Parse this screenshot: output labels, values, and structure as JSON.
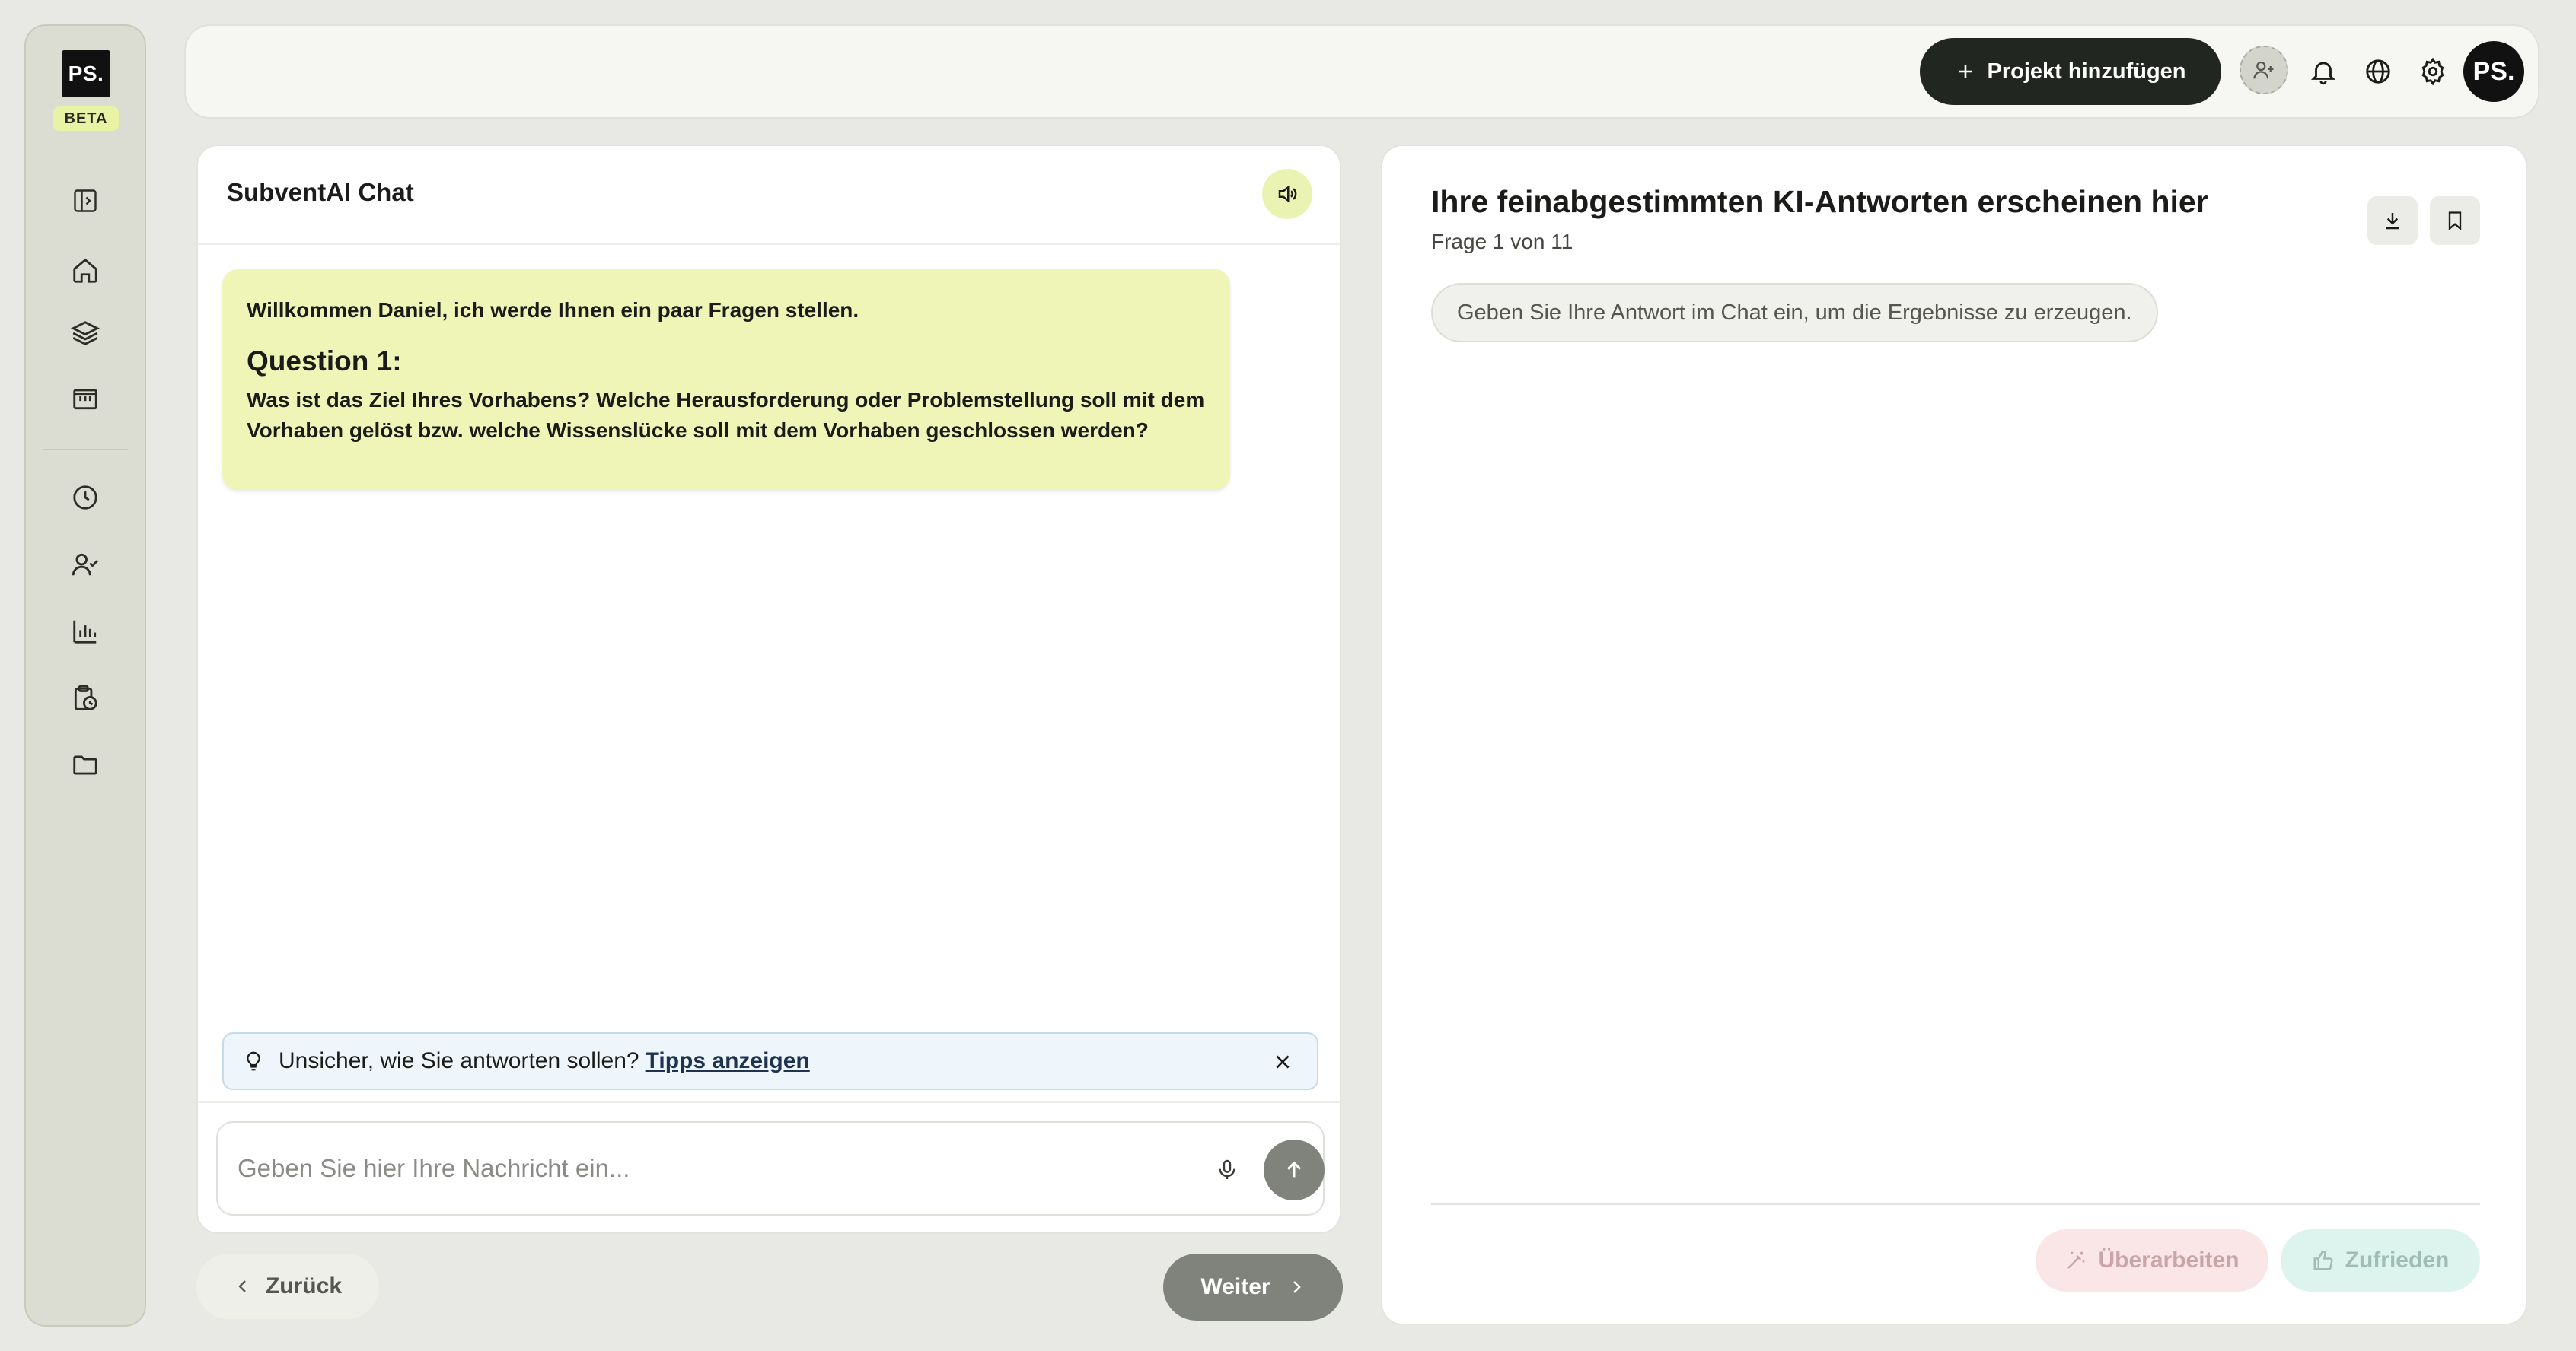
{
  "sidebar": {
    "logo_text": "PS.",
    "beta_label": "BETA",
    "items": [
      {
        "icon": "sidebar-toggle-icon"
      },
      {
        "icon": "home-icon"
      },
      {
        "icon": "layers-icon"
      },
      {
        "icon": "building-icon"
      },
      {
        "icon": "clock-icon"
      },
      {
        "icon": "user-check-icon"
      },
      {
        "icon": "bar-chart-icon"
      },
      {
        "icon": "clipboard-clock-icon"
      },
      {
        "icon": "folder-icon"
      }
    ]
  },
  "topbar": {
    "add_project_label": "Projekt hinzufügen",
    "avatar_text": "PS."
  },
  "chat": {
    "title": "SubventAI Chat",
    "greeting": "Willkommen Daniel, ich werde Ihnen ein paar Fragen stellen.",
    "question_heading": "Question 1:",
    "question_text": "Was ist das Ziel Ihres Vorhabens? Welche Herausforderung oder Problemstellung soll mit dem Vorhaben gelöst bzw. welche Wissenslücke soll mit dem Vorhaben geschlossen werden?",
    "tips_text": "Unsicher, wie Sie antworten sollen?",
    "tips_link": "Tipps anzeigen",
    "input_placeholder": "Geben Sie hier Ihre Nachricht ein...",
    "input_value": ""
  },
  "nav": {
    "back_label": "Zurück",
    "next_label": "Weiter"
  },
  "answers": {
    "title": "Ihre feinabgestimmten KI-Antworten erscheinen hier",
    "subtitle": "Frage 1 von 11",
    "hint": "Geben Sie Ihre Antwort im Chat ein, um die Ergebnisse zu erzeugen.",
    "revise_label": "Überarbeiten",
    "satisfied_label": "Zufrieden"
  },
  "colors": {
    "accent_lime": "#eef5b7",
    "dark_button": "#222620",
    "revise_bg": "#fbe6e7",
    "satisfied_bg": "#ddf4ee"
  }
}
